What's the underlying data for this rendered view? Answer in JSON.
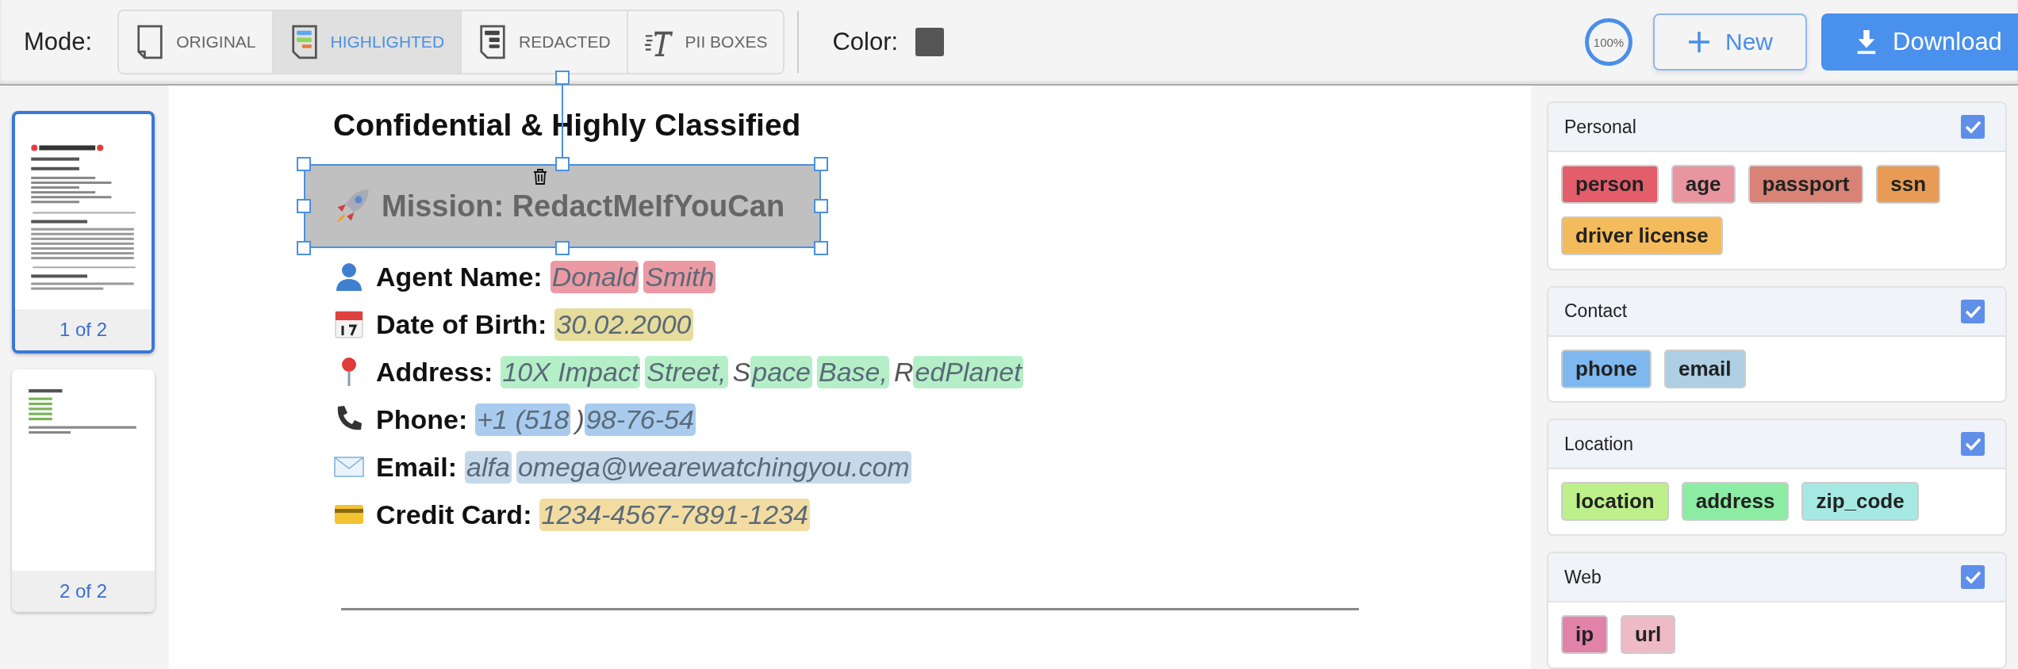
{
  "toolbar": {
    "mode_label": "Mode:",
    "modes": [
      {
        "label": "ORIGINAL",
        "kind": "original",
        "selected": false
      },
      {
        "label": "HIGHLIGHTED",
        "kind": "highlighted",
        "selected": true
      },
      {
        "label": "REDACTED",
        "kind": "redacted",
        "selected": false
      },
      {
        "label": "PII BOXES",
        "kind": "pii",
        "selected": false
      }
    ],
    "color_label": "Color:",
    "color": "#555555",
    "zoom": "100%",
    "buttons": [
      {
        "label": "New",
        "kind": "new"
      },
      {
        "label": "Download",
        "kind": "download"
      }
    ]
  },
  "pages": [
    {
      "label": "1 of 2",
      "kind": "first",
      "selected": true
    },
    {
      "label": "2 of 2",
      "kind": "second",
      "selected": false
    }
  ],
  "document": {
    "heading": "Confidential & Highly Classified",
    "redaction": {
      "text": "Mission: RedactMeIfYouCan"
    },
    "fields": [
      {
        "kind": "person",
        "label": "Agent Name:",
        "segments": [
          {
            "text": "Donald",
            "color": "#eb9aa4"
          },
          {
            "text": "Smith",
            "color": "#eb9aa4"
          }
        ]
      },
      {
        "kind": "calendar",
        "label": "Date of Birth:",
        "segments": [
          {
            "text": "30.02.2000",
            "color": "#e6dc9c"
          }
        ]
      },
      {
        "kind": "pin",
        "label": "Address:",
        "segments": [
          {
            "text": "10X Impact",
            "color": "#b5efc8"
          },
          {
            "text": "Street,",
            "color": "#b5efc8"
          },
          {
            "text": "S"
          },
          {
            "text": "pace",
            "color": "#b5efc8"
          },
          {
            "text": "Base,",
            "color": "#b5efc8"
          },
          {
            "text": "R"
          },
          {
            "text": "edPlanet",
            "color": "#b5efc8"
          }
        ]
      },
      {
        "kind": "phone",
        "label": "Phone:",
        "segments": [
          {
            "text": "+1 (518",
            "color": "#a9cbee"
          },
          {
            "text": ")"
          },
          {
            "text": "98-76-54",
            "color": "#a9cbee"
          }
        ]
      },
      {
        "kind": "email",
        "label": "Email:",
        "segments": [
          {
            "text": "alfa",
            "color": "#c5d9ea"
          },
          {
            "text": "omega@wearewatchingyou.com",
            "color": "#c5d9ea"
          }
        ]
      },
      {
        "kind": "card",
        "label": "Credit Card:",
        "segments": [
          {
            "text": "1234-4567-7891-1234",
            "color": "#f2dca2"
          }
        ]
      }
    ]
  },
  "categories": [
    {
      "name": "Personal",
      "checked": true,
      "tags": [
        {
          "label": "person",
          "color": "#e35d6a"
        },
        {
          "label": "age",
          "color": "#e895a0"
        },
        {
          "label": "passport",
          "color": "#d88375"
        },
        {
          "label": "ssn",
          "color": "#e89b55"
        },
        {
          "label": "driver license",
          "color": "#f4bb5c"
        }
      ]
    },
    {
      "name": "Contact",
      "checked": true,
      "tags": [
        {
          "label": "phone",
          "color": "#7fb8ee"
        },
        {
          "label": "email",
          "color": "#aecfe3"
        }
      ]
    },
    {
      "name": "Location",
      "checked": true,
      "tags": [
        {
          "label": "location",
          "color": "#bdf08b"
        },
        {
          "label": "address",
          "color": "#8deca4"
        },
        {
          "label": "zip_code",
          "color": "#a6e9e3"
        }
      ]
    },
    {
      "name": "Web",
      "checked": true,
      "tags": [
        {
          "label": "ip",
          "color": "#e183a8"
        },
        {
          "label": "url",
          "color": "#eebac6"
        }
      ]
    }
  ]
}
